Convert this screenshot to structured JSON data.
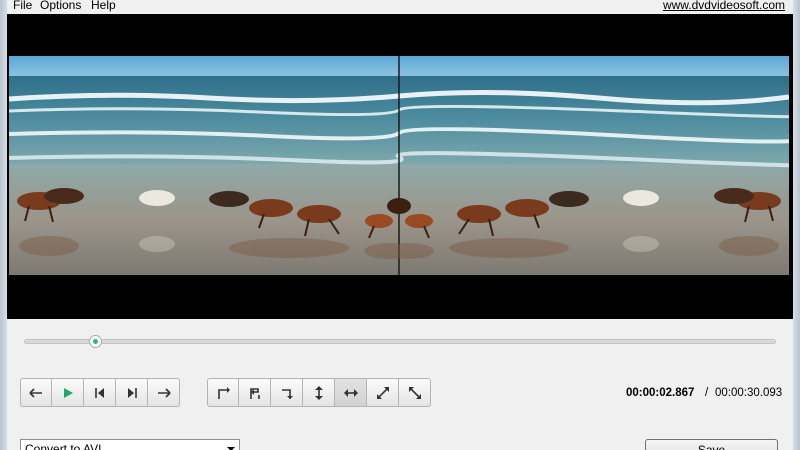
{
  "menu": {
    "items": [
      {
        "label": "File"
      },
      {
        "label": "Options"
      },
      {
        "label": "Help"
      }
    ],
    "site_link": "www.dvdvideosoft.com"
  },
  "video": {
    "description_icon": "video-preview",
    "seek_progress": 0.095
  },
  "playback": {
    "buttons": [
      {
        "icon": "arrow-left-icon"
      },
      {
        "icon": "play-icon"
      },
      {
        "icon": "skip-back-icon"
      },
      {
        "icon": "skip-forward-icon"
      },
      {
        "icon": "arrow-right-icon"
      }
    ]
  },
  "transform": {
    "buttons": [
      {
        "icon": "rotate-left-icon"
      },
      {
        "icon": "rotate-180-icon"
      },
      {
        "icon": "rotate-right-icon"
      },
      {
        "icon": "flip-vertical-icon"
      },
      {
        "icon": "flip-horizontal-icon",
        "active": true
      },
      {
        "icon": "transpose-icon"
      },
      {
        "icon": "transverse-icon"
      }
    ]
  },
  "time": {
    "current": "00:00:02.867",
    "separator": "/",
    "total": "00:00:30.093"
  },
  "format": {
    "selected": "Convert to AVI"
  },
  "save_label": "Save"
}
